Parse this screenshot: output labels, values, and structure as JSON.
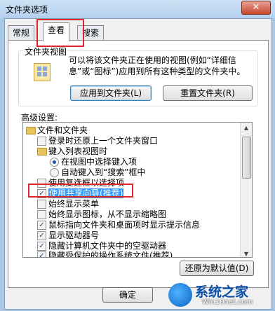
{
  "window": {
    "title": "文件夹选项",
    "close_label": "✕"
  },
  "tabs": [
    {
      "label": "常规"
    },
    {
      "label": "查看"
    },
    {
      "label": "搜索"
    }
  ],
  "folder_views": {
    "title": "文件夹视图",
    "description": "可以将该文件夹正在使用的视图(例如“详细信息”或“图标”)应用到所有这种类型的文件夹中。",
    "apply_button": "应用到文件夹(L)",
    "reset_button": "重置文件夹(R)"
  },
  "advanced": {
    "label": "高级设置:",
    "items": [
      {
        "type": "folder",
        "text": "文件和文件夹"
      },
      {
        "type": "checkbox",
        "text": "登录时还原上一个文件夹窗口",
        "checked": false
      },
      {
        "type": "folder",
        "text": "键入列表视图时"
      },
      {
        "type": "radio",
        "text": "在视图中选择键入项",
        "checked": true
      },
      {
        "type": "radio",
        "text": "自动键入到“搜索”框中",
        "checked": false
      },
      {
        "type": "checkbox",
        "text": "使用复选框以选择项",
        "checked": false
      },
      {
        "type": "checkbox",
        "text": "使用共享向导(推荐)",
        "checked": true
      },
      {
        "type": "checkbox",
        "text": "始终显示菜单",
        "checked": false
      },
      {
        "type": "checkbox",
        "text": "始终显示图标，从不显示缩略图",
        "checked": false
      },
      {
        "type": "checkbox",
        "text": "鼠标指向文件夹和桌面项时显示提示信息",
        "checked": true
      },
      {
        "type": "checkbox",
        "text": "显示驱动器号",
        "checked": true
      },
      {
        "type": "checkbox",
        "text": "隐藏计算机文件夹中的空驱动器",
        "checked": true
      },
      {
        "type": "checkbox",
        "text": "隐藏受保护的操作系统文件(推荐)",
        "checked": true
      }
    ],
    "restore_button": "还原为默认值(D)"
  },
  "footer": {
    "ok_button": "确定"
  },
  "watermark": {
    "brand": "系统之家",
    "url": "Win10net.com"
  },
  "colors": {
    "highlight": "#e0262a",
    "selection": "#3399ff"
  },
  "icons": {
    "close": "close-icon",
    "folder": "folder-icon",
    "view": "folder-view-icon"
  }
}
